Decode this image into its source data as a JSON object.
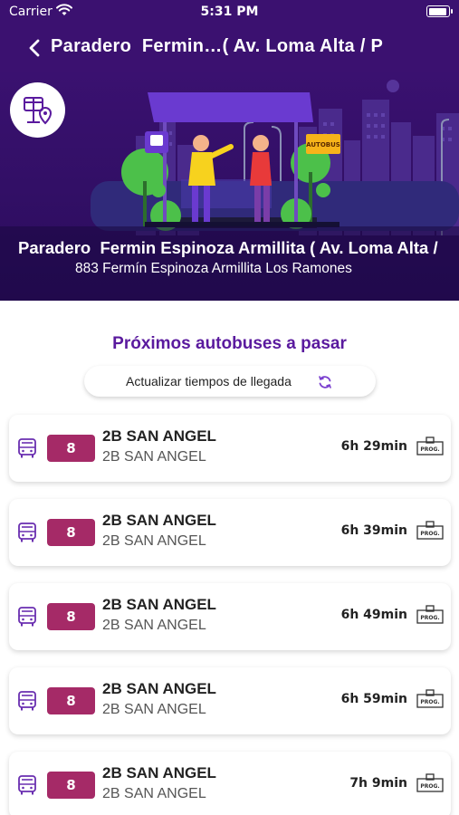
{
  "status_bar": {
    "carrier": "Carrier",
    "time": "5:31 PM",
    "wifi_icon": "wifi-icon",
    "battery_icon": "battery-icon"
  },
  "nav": {
    "back_icon": "chevron-left-icon",
    "title": "Paradero  Fermin…( Av. Loma Alta / P"
  },
  "hero": {
    "stop_icon": "bus-stop-location-icon",
    "stop_name": "Paradero  Fermin Espinoza Armillita ( Av. Loma Alta / P",
    "stop_address": "883 Fermín Espinoza Armillita Los Ramones",
    "illustration_sign": "AUTOBUS"
  },
  "section": {
    "title": "Próximos autobuses a pasar",
    "refresh_label": "Actualizar tiempos de llegada",
    "refresh_icon": "refresh-icon"
  },
  "colors": {
    "header_purple": "#3b1170",
    "title_purple": "#5a1a9e",
    "route_badge": "#a52a67",
    "bus_icon": "#6a2fb0"
  },
  "arrivals": [
    {
      "route": "8",
      "name": "2B SAN ANGEL",
      "subtitle": "2B SAN ANGEL",
      "eta": "6h 29min",
      "icon": "bus-icon",
      "status_icon": "scheduled-prog-icon",
      "status_label": "PROG."
    },
    {
      "route": "8",
      "name": "2B SAN ANGEL",
      "subtitle": "2B SAN ANGEL",
      "eta": "6h 39min",
      "icon": "bus-icon",
      "status_icon": "scheduled-prog-icon",
      "status_label": "PROG."
    },
    {
      "route": "8",
      "name": "2B SAN ANGEL",
      "subtitle": "2B SAN ANGEL",
      "eta": "6h 49min",
      "icon": "bus-icon",
      "status_icon": "scheduled-prog-icon",
      "status_label": "PROG."
    },
    {
      "route": "8",
      "name": "2B SAN ANGEL",
      "subtitle": "2B SAN ANGEL",
      "eta": "6h 59min",
      "icon": "bus-icon",
      "status_icon": "scheduled-prog-icon",
      "status_label": "PROG."
    },
    {
      "route": "8",
      "name": "2B SAN ANGEL",
      "subtitle": "2B SAN ANGEL",
      "eta": "7h 9min",
      "icon": "bus-icon",
      "status_icon": "scheduled-prog-icon",
      "status_label": "PROG."
    }
  ]
}
